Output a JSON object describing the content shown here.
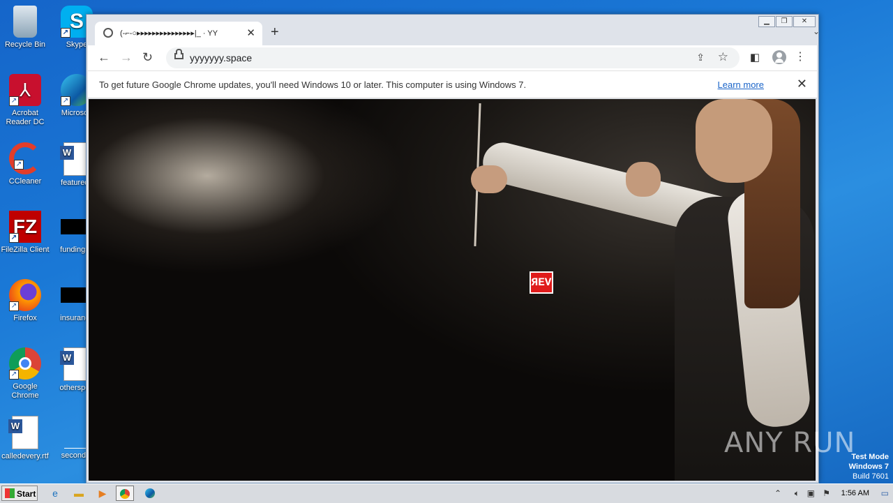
{
  "desktop": {
    "icons": [
      {
        "label": "Recycle Bin"
      },
      {
        "label": "Skype"
      },
      {
        "label": "Acrobat Reader DC"
      },
      {
        "label": "Microsoft"
      },
      {
        "label": "CCleaner"
      },
      {
        "label": "featureds"
      },
      {
        "label": "FileZilla Client"
      },
      {
        "label": "fundingse"
      },
      {
        "label": "Firefox"
      },
      {
        "label": "insurance"
      },
      {
        "label": "Google Chrome"
      },
      {
        "label": "otherspoo"
      },
      {
        "label": "calledevery.rtf"
      },
      {
        "label": "secondto"
      }
    ]
  },
  "browser": {
    "tab_title": "(-⌐-○▸▸▸▸▸▸▸▸▸▸▸▸▸▸▸|_ · YY",
    "url": "yyyyyyy.space",
    "infobar_message": "To get future Google Chrome updates, you'll need Windows 10 or later. This computer is using Windows 7.",
    "infobar_link": "Learn more"
  },
  "content": {
    "badge_text": "ЯEV",
    "watermark": "ANY RUN"
  },
  "os": {
    "test_mode_line1": "Test Mode",
    "test_mode_line2": "Windows 7",
    "test_mode_line3": "Build 7601",
    "start_label": "Start",
    "clock": "1:56 AM"
  },
  "colors": {
    "desktop_bg": "#1a78d6",
    "badge_red": "#e01b1b",
    "link_blue": "#1a64c8"
  }
}
